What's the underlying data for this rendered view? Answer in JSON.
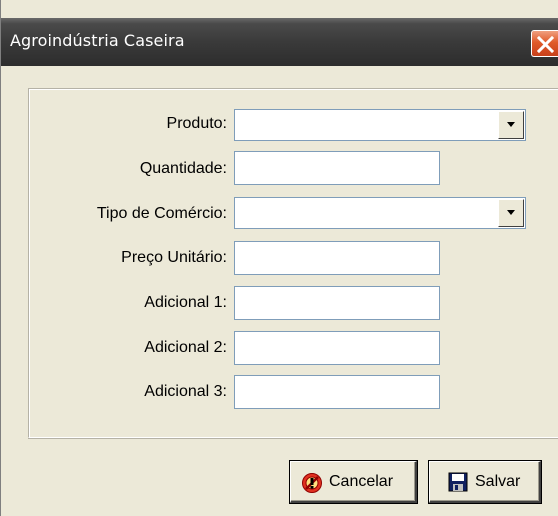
{
  "window": {
    "title": "Agroindústria Caseira"
  },
  "form": {
    "fields": [
      {
        "label": "Produto:",
        "type": "combo",
        "value": ""
      },
      {
        "label": "Quantidade:",
        "type": "text",
        "value": ""
      },
      {
        "label": "Tipo de Comércio:",
        "type": "combo",
        "value": ""
      },
      {
        "label": "Preço Unitário:",
        "type": "text",
        "value": ""
      },
      {
        "label": "Adicional 1:",
        "type": "text",
        "value": ""
      },
      {
        "label": "Adicional 2:",
        "type": "text",
        "value": ""
      },
      {
        "label": "Adicional 3:",
        "type": "text",
        "value": ""
      }
    ]
  },
  "buttons": {
    "cancel_label": "Cancelar",
    "save_label": "Salvar"
  },
  "icons": {
    "close": "close-icon",
    "combo_arrow": "chevron-down-icon",
    "cancel": "cancel-icon",
    "save": "floppy-disk-icon"
  },
  "colors": {
    "titlebar": "#3a3a3a",
    "close_button": "#e05a2a",
    "window_face": "#ece9d8",
    "field_border": "#7f9db9"
  }
}
